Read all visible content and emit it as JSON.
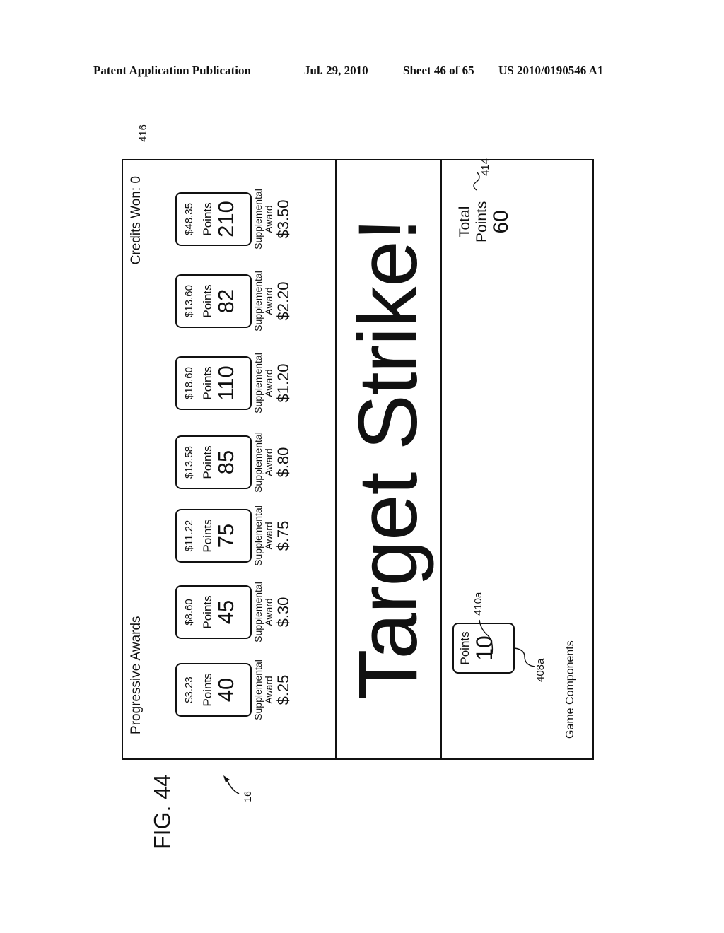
{
  "header": {
    "publication": "Patent Application Publication",
    "date": "Jul. 29, 2010",
    "sheet": "Sheet 46 of 65",
    "number": "US 2010/0190546 A1"
  },
  "figure": {
    "label": "FIG. 44",
    "ref_display": "16"
  },
  "screen": {
    "progressive_label": "Progressive Awards",
    "credits_won": "Credits Won: 0",
    "credits_ref": "416",
    "awards": [
      {
        "amount": "$3.23",
        "points_label": "Points",
        "points": "40",
        "supp_label_1": "Supplemental",
        "supp_label_2": "Award",
        "supp_amount": "$.25"
      },
      {
        "amount": "$8.60",
        "points_label": "Points",
        "points": "45",
        "supp_label_1": "Supplemental",
        "supp_label_2": "Award",
        "supp_amount": "$.30"
      },
      {
        "amount": "$11.22",
        "points_label": "Points",
        "points": "75",
        "supp_label_1": "Supplemental",
        "supp_label_2": "Award",
        "supp_amount": "$.75"
      },
      {
        "amount": "$13.58",
        "points_label": "Points",
        "points": "85",
        "supp_label_1": "Supplemental",
        "supp_label_2": "Award",
        "supp_amount": "$.80"
      },
      {
        "amount": "$18.60",
        "points_label": "Points",
        "points": "110",
        "supp_label_1": "Supplemental",
        "supp_label_2": "Award",
        "supp_amount": "$1.20"
      },
      {
        "amount": "$13.60",
        "points_label": "Points",
        "points": "82",
        "supp_label_1": "Supplemental",
        "supp_label_2": "Award",
        "supp_amount": "$2.20"
      },
      {
        "amount": "$48.35",
        "points_label": "Points",
        "points": "210",
        "supp_label_1": "Supplemental",
        "supp_label_2": "Award",
        "supp_amount": "$3.50"
      }
    ],
    "title": "Target Strike!",
    "component": {
      "points_label": "Points",
      "points": "10",
      "ref_card": "408a",
      "ref_value": "410a"
    },
    "game_components_label": "Game Components",
    "total": {
      "line1": "Total",
      "line2": "Points",
      "value": "60",
      "ref": "414"
    }
  }
}
